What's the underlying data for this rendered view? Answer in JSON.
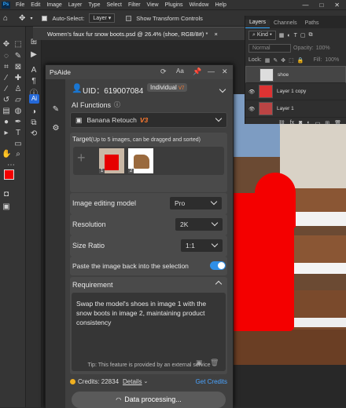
{
  "menubar": {
    "ps": "Ps",
    "items": [
      "File",
      "Edit",
      "Image",
      "Layer",
      "Type",
      "Select",
      "Filter",
      "View",
      "Plugins",
      "Window",
      "Help"
    ],
    "win": [
      "—",
      "□",
      "✕"
    ]
  },
  "options": {
    "auto_select": "Auto-Select:",
    "layer_select": "Layer",
    "show_transform": "Show Transform Controls"
  },
  "doc_tab": "Women's faux fur snow boots.psd @ 26.4% (shoe, RGB/8#) *",
  "doc_tab_close": "×",
  "layers_panel": {
    "tabs": [
      "Layers",
      "Channels",
      "Paths"
    ],
    "kind": "Kind",
    "blend": "Normal",
    "opacity_label": "Opacity:",
    "opacity": "100%",
    "lock_label": "Lock:",
    "fill_label": "Fill:",
    "fill": "100%",
    "layers": [
      "shoe",
      "Layer 1 copy",
      "Layer 1"
    ]
  },
  "plugin": {
    "title": "PsAide",
    "uid": "UID：619007084",
    "account_type": "Individual",
    "account_version": "V7",
    "ai_functions_label": "AI Functions",
    "function_select": "Banana Retouch",
    "function_version": "V3",
    "target_label": "Target",
    "target_hint": "(Up to 5 images, can be dragged and sorted)",
    "add_symbol": "+",
    "images": [
      {
        "index": "1"
      },
      {
        "index": "2"
      }
    ],
    "model_label": "Image editing model",
    "model_value": "Pro",
    "resolution_label": "Resolution",
    "resolution_value": "2K",
    "ratio_label": "Size Ratio",
    "ratio_value": "1:1",
    "paste_back_label": "Paste the image back into the selection",
    "paste_back_on": true,
    "requirement_label": "Requirement",
    "requirement_text": "Swap the model's shoes in image 1 with the snow boots in image 2, maintaining product consistency",
    "tip": "Tip: This feature is provided by an external service",
    "credits": "Credits: 22834",
    "details": "Details",
    "get_credits": "Get Credits",
    "status": "Data processing..."
  },
  "colors": {
    "accent": "#31a8ff",
    "toggle": "#2e8fe8",
    "version": "#ff7a2f",
    "selection_red": "#f40000",
    "get_credits": "#4aa3ff"
  }
}
